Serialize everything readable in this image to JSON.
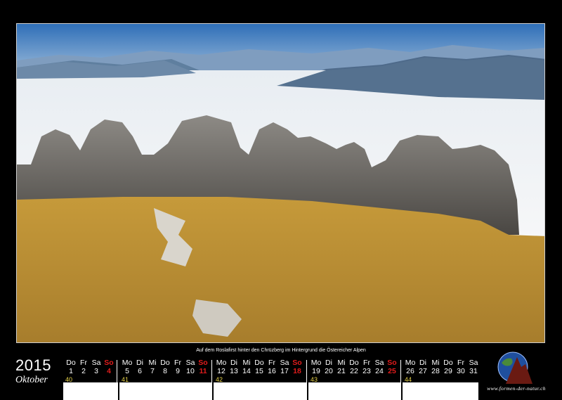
{
  "caption": "Auf dem Roslafirst hinter den Chrüzberg im Hintergrund die Östereicher Alpen",
  "year": "2015",
  "month": "Oktober",
  "weeks": [
    {
      "week": "40",
      "days": [
        "Do",
        "Fr",
        "Sa",
        "So"
      ],
      "dates": [
        "1",
        "2",
        "3",
        "4"
      ]
    },
    {
      "week": "41",
      "days": [
        "Mo",
        "Di",
        "Mi",
        "Do",
        "Fr",
        "Sa",
        "So"
      ],
      "dates": [
        "5",
        "6",
        "7",
        "8",
        "9",
        "10",
        "11"
      ]
    },
    {
      "week": "42",
      "days": [
        "Mo",
        "Di",
        "Mi",
        "Do",
        "Fr",
        "Sa",
        "So"
      ],
      "dates": [
        "12",
        "13",
        "14",
        "15",
        "16",
        "17",
        "18"
      ]
    },
    {
      "week": "43",
      "days": [
        "Mo",
        "Di",
        "Mi",
        "Do",
        "Fr",
        "Sa",
        "So"
      ],
      "dates": [
        "19",
        "20",
        "21",
        "22",
        "23",
        "24",
        "25"
      ]
    },
    {
      "week": "44",
      "days": [
        "Mo",
        "Di",
        "Mi",
        "Do",
        "Fr",
        "Sa"
      ],
      "dates": [
        "26",
        "27",
        "28",
        "29",
        "30",
        "31"
      ]
    }
  ],
  "website": "www.formen-der-natur.ch",
  "colors": {
    "sunday": "#e21c1c",
    "week_number": "#e8d44a",
    "background": "#000000"
  }
}
